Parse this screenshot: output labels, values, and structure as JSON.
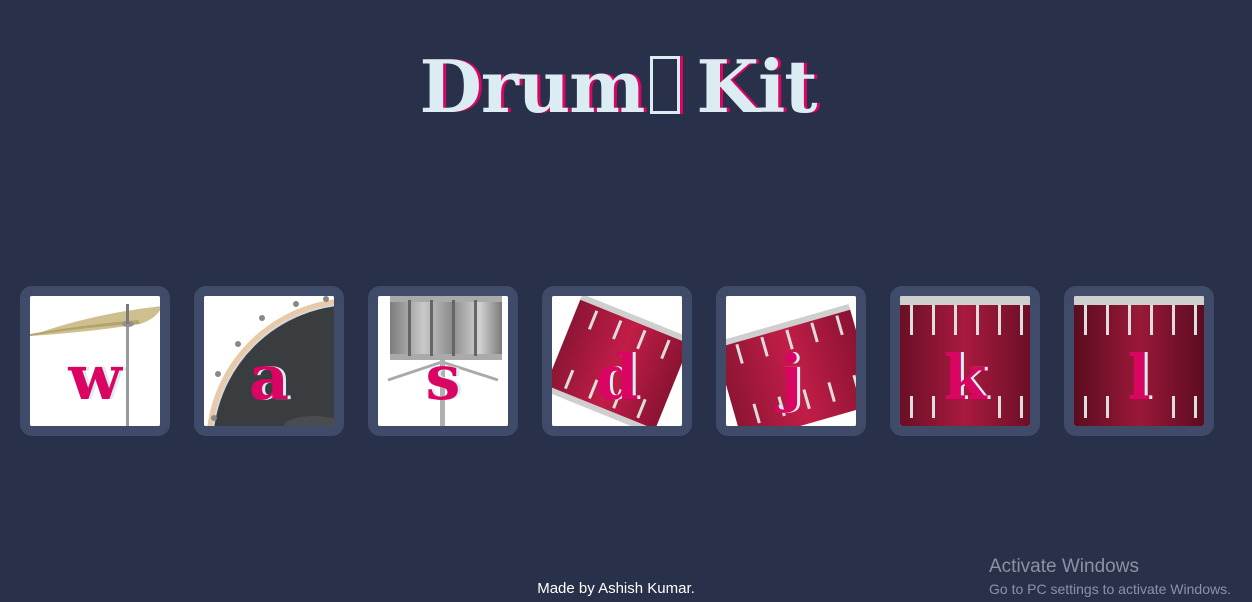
{
  "header": {
    "title_before": "Drum",
    "title_after": "Kit",
    "title_glyph_icon": "missing-glyph-box"
  },
  "drums": [
    {
      "key": "w",
      "icon": "crash-cymbal-icon"
    },
    {
      "key": "a",
      "icon": "kick-drum-icon"
    },
    {
      "key": "s",
      "icon": "snare-drum-icon"
    },
    {
      "key": "d",
      "icon": "tom-1-icon"
    },
    {
      "key": "j",
      "icon": "tom-2-icon"
    },
    {
      "key": "k",
      "icon": "tom-3-icon"
    },
    {
      "key": "l",
      "icon": "tom-4-icon"
    }
  ],
  "footer": {
    "text": "Made by Ashish Kumar."
  },
  "watermark": {
    "title": "Activate Windows",
    "subtitle": "Go to PC settings to activate Windows."
  },
  "colors": {
    "background": "#283149",
    "button_border": "#404b69",
    "accent": "#da0463",
    "title": "#dbedf3"
  }
}
